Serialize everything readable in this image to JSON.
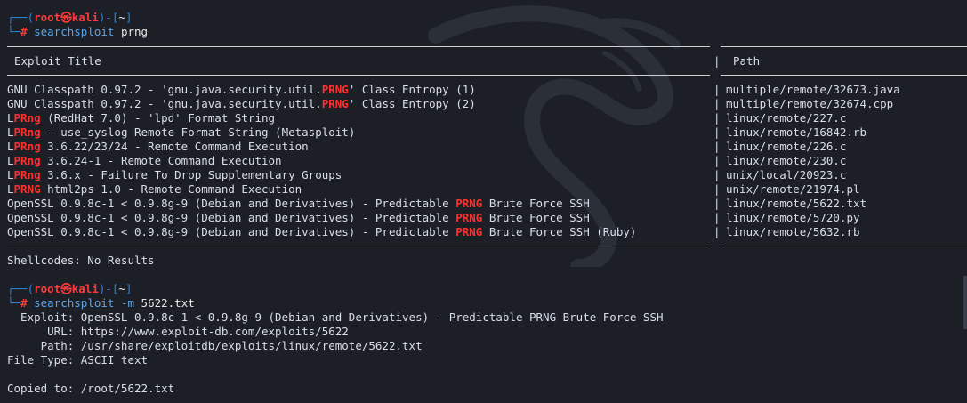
{
  "prompt": {
    "user": "root",
    "host": "kali",
    "cwd": "~",
    "symbol": "㉿",
    "hash": "#"
  },
  "command1": {
    "program": "searchsploit",
    "args": " prng"
  },
  "table": {
    "header_title": "Exploit Title",
    "header_path": "Path",
    "rows": [
      {
        "pre": "GNU Classpath 0.97.2 - 'gnu.java.security.util.",
        "hl": "PRNG",
        "post": "' Class Entropy (1)",
        "path": "multiple/remote/32673.java"
      },
      {
        "pre": "GNU Classpath 0.97.2 - 'gnu.java.security.util.",
        "hl": "PRNG",
        "post": "' Class Entropy (2)",
        "path": "multiple/remote/32674.cpp"
      },
      {
        "pre": "L",
        "hl": "PRng",
        "post": " (RedHat 7.0) - 'lpd' Format String",
        "path": "linux/remote/227.c"
      },
      {
        "pre": "L",
        "hl": "PRng",
        "post": " - use_syslog Remote Format String (Metasploit)",
        "path": "linux/remote/16842.rb"
      },
      {
        "pre": "L",
        "hl": "PRng",
        "post": " 3.6.22/23/24 - Remote Command Execution",
        "path": "linux/remote/226.c"
      },
      {
        "pre": "L",
        "hl": "PRng",
        "post": " 3.6.24-1 - Remote Command Execution",
        "path": "linux/remote/230.c"
      },
      {
        "pre": "L",
        "hl": "PRng",
        "post": " 3.6.x - Failure To Drop Supplementary Groups",
        "path": "unix/local/20923.c"
      },
      {
        "pre": "L",
        "hl": "PRNG",
        "post": " html2ps 1.0 - Remote Command Execution",
        "path": "unix/remote/21974.pl"
      },
      {
        "pre": "OpenSSL 0.9.8c-1 < 0.9.8g-9 (Debian and Derivatives) - Predictable ",
        "hl": "PRNG",
        "post": " Brute Force SSH",
        "path": "linux/remote/5622.txt"
      },
      {
        "pre": "OpenSSL 0.9.8c-1 < 0.9.8g-9 (Debian and Derivatives) - Predictable ",
        "hl": "PRNG",
        "post": " Brute Force SSH",
        "path": "linux/remote/5720.py"
      },
      {
        "pre": "OpenSSL 0.9.8c-1 < 0.9.8g-9 (Debian and Derivatives) - Predictable ",
        "hl": "PRNG",
        "post": " Brute Force SSH (Ruby)",
        "path": "linux/remote/5632.rb"
      }
    ]
  },
  "shellcodes": "Shellcodes: No Results",
  "command2": {
    "program": "searchsploit",
    "flag": " -m",
    "args": " 5622.txt"
  },
  "mirror": {
    "exploit": "  Exploit: OpenSSL 0.9.8c-1 < 0.9.8g-9 (Debian and Derivatives) - Predictable PRNG Brute Force SSH",
    "url": "      URL: https://www.exploit-db.com/exploits/5622",
    "path": "     Path: /usr/share/exploitdb/exploits/linux/remote/5622.txt",
    "filetype": "File Type: ASCII text",
    "copied": "Copied to: /root/5622.txt"
  },
  "colors": {
    "background": "#1c1f26",
    "prompt_frame": "#2e80d6",
    "prompt_user": "#ff3a3a",
    "highlight": "#ff3030",
    "command": "#5ea6e8"
  }
}
